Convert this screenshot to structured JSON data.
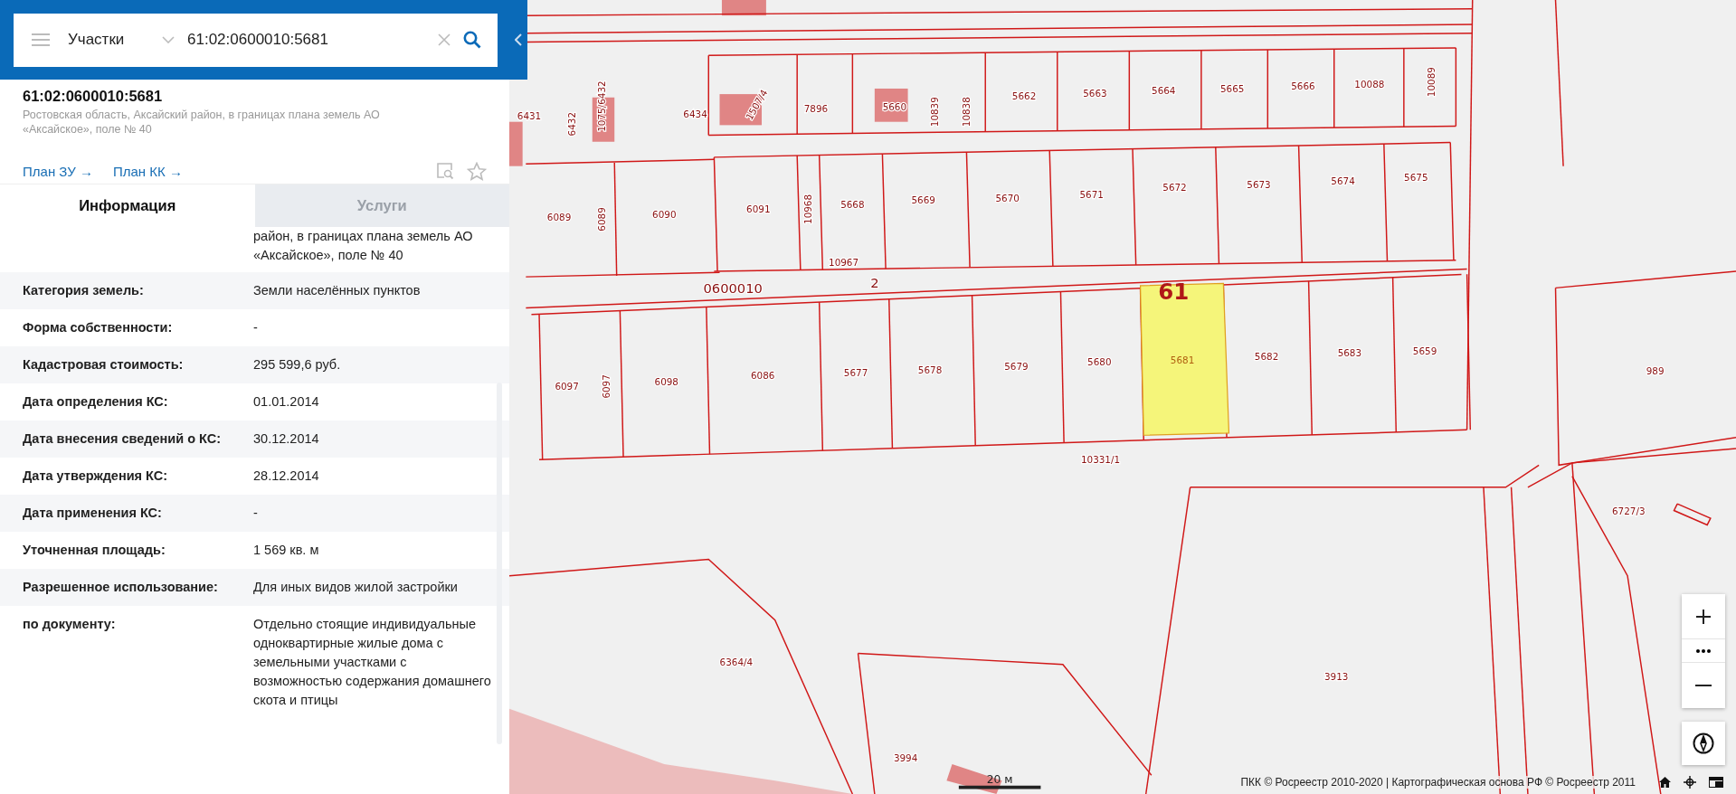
{
  "search": {
    "layer": "Участки",
    "value": "61:02:0600010:5681"
  },
  "parcel": {
    "number": "61:02:0600010:5681",
    "address": "Ростовская область, Аксайский район, в границах плана земель АО «Аксайское», поле № 40",
    "links": [
      "План ЗУ →",
      "План КК →"
    ]
  },
  "tabs": [
    {
      "label": "Информация",
      "selected": true
    },
    {
      "label": "Услуги",
      "selected": false
    }
  ],
  "rows": [
    {
      "value": "район, в границах плана земель АО «Аксайское», поле № 40"
    },
    {
      "label": "Категория земель:",
      "value": "Земли населённых пунктов"
    },
    {
      "label": "Форма собственности:",
      "value": "-"
    },
    {
      "label": "Кадастровая стоимость:",
      "value": "295 599,6 руб."
    },
    {
      "label": "Дата определения КС:",
      "value": "01.01.2014"
    },
    {
      "label": "Дата внесения сведений о КС:",
      "value": "30.12.2014"
    },
    {
      "label": "Дата утверждения КС:",
      "value": "28.12.2014"
    },
    {
      "label": "Дата применения КС:",
      "value": "-"
    },
    {
      "label": "Уточненная площадь:",
      "value": "1 569 кв. м"
    },
    {
      "label": "Разрешенное использование:",
      "value": "Для иных видов жилой застройки"
    },
    {
      "label": "по документу:",
      "value": "Отдельно стоящие индивидуальные одноквартирные жилые дома с земельными участками с возможностью содержания домашнего скота и птицы"
    }
  ],
  "map": {
    "labels": [
      {
        "text": "6431",
        "kind": "parcel"
      },
      {
        "text": "6432",
        "kind": "parcel"
      },
      {
        "text": "1075/6432",
        "kind": "parcel"
      },
      {
        "text": "6434",
        "kind": "parcel"
      },
      {
        "text": "1507/4",
        "kind": "parcel"
      },
      {
        "text": "7896",
        "kind": "parcel"
      },
      {
        "text": "5660",
        "kind": "parcel"
      },
      {
        "text": "10839",
        "kind": "parcel"
      },
      {
        "text": "10838",
        "kind": "parcel"
      },
      {
        "text": "5662",
        "kind": "parcel"
      },
      {
        "text": "5663",
        "kind": "parcel"
      },
      {
        "text": "5664",
        "kind": "parcel"
      },
      {
        "text": "5665",
        "kind": "parcel"
      },
      {
        "text": "5666",
        "kind": "parcel"
      },
      {
        "text": "10088",
        "kind": "parcel"
      },
      {
        "text": "10089",
        "kind": "parcel"
      },
      {
        "text": "6089",
        "kind": "parcel"
      },
      {
        "text": "6089",
        "kind": "parcel"
      },
      {
        "text": "6090",
        "kind": "parcel"
      },
      {
        "text": "6091",
        "kind": "parcel"
      },
      {
        "text": "10968",
        "kind": "parcel"
      },
      {
        "text": "5668",
        "kind": "parcel"
      },
      {
        "text": "5669",
        "kind": "parcel"
      },
      {
        "text": "5670",
        "kind": "parcel"
      },
      {
        "text": "5671",
        "kind": "parcel"
      },
      {
        "text": "5672",
        "kind": "parcel"
      },
      {
        "text": "5673",
        "kind": "parcel"
      },
      {
        "text": "5674",
        "kind": "parcel"
      },
      {
        "text": "5675",
        "kind": "parcel"
      },
      {
        "text": "10967",
        "kind": "parcel"
      },
      {
        "text": "0600010",
        "kind": "quarter"
      },
      {
        "text": "2",
        "kind": "quarter"
      },
      {
        "text": "61",
        "kind": "block"
      },
      {
        "text": "6097",
        "kind": "parcel"
      },
      {
        "text": "6097",
        "kind": "parcel"
      },
      {
        "text": "6098",
        "kind": "parcel"
      },
      {
        "text": "6086",
        "kind": "parcel"
      },
      {
        "text": "5677",
        "kind": "parcel"
      },
      {
        "text": "5678",
        "kind": "parcel"
      },
      {
        "text": "5679",
        "kind": "parcel"
      },
      {
        "text": "5680",
        "kind": "parcel"
      },
      {
        "text": "5681",
        "kind": "selected"
      },
      {
        "text": "5682",
        "kind": "parcel"
      },
      {
        "text": "5683",
        "kind": "parcel"
      },
      {
        "text": "5659",
        "kind": "parcel"
      },
      {
        "text": "989",
        "kind": "parcel"
      },
      {
        "text": "10331/1",
        "kind": "parcel"
      },
      {
        "text": "6727/3",
        "kind": "parcel"
      },
      {
        "text": "6364/4",
        "kind": "parcel"
      },
      {
        "text": "3913",
        "kind": "parcel"
      },
      {
        "text": "3994",
        "kind": "parcel"
      }
    ],
    "scale": "20 м",
    "attribution": "ПКК © Росреестр 2010-2020 | Картографическая основа РФ © Росреестр 2011"
  }
}
